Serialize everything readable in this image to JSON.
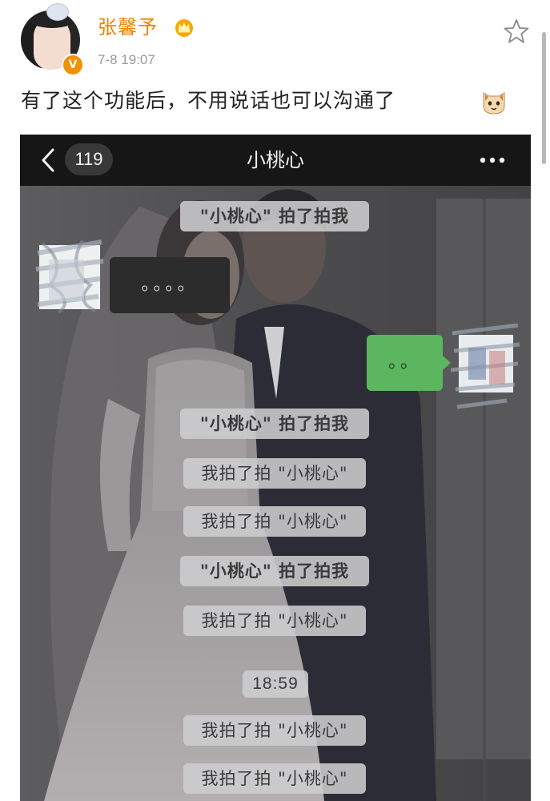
{
  "post": {
    "username": "张馨予",
    "timestamp": "7-8 19:07",
    "verified_mark": "V",
    "text": "有了这个功能后，不用说话也可以沟通了",
    "icons": {
      "crown": "crown-icon",
      "star": "star-icon",
      "emoji": "cat-emoji-icon"
    }
  },
  "chat": {
    "back_icon": "chevron-left-icon",
    "unread_count": "119",
    "title": "小桃心",
    "more_icon": "ellipsis-icon",
    "incoming_message": "。。。。",
    "outgoing_message": "。。",
    "time_divider": "18:59",
    "system_notices": [
      "\"小桃心\" 拍了拍我",
      "\"小桃心\" 拍了拍我",
      "我拍了拍 \"小桃心\"",
      "我拍了拍 \"小桃心\"",
      "\"小桃心\" 拍了拍我",
      "我拍了拍 \"小桃心\"",
      "我拍了拍 \"小桃心\"",
      "我拍了拍 \"小桃心\""
    ]
  },
  "colors": {
    "username": "#f08300",
    "timestamp": "#9b9b9b",
    "chat_topbar": "#161616",
    "outgoing_bubble": "#5cb55f",
    "notice_pill": "#cdcdcf"
  }
}
